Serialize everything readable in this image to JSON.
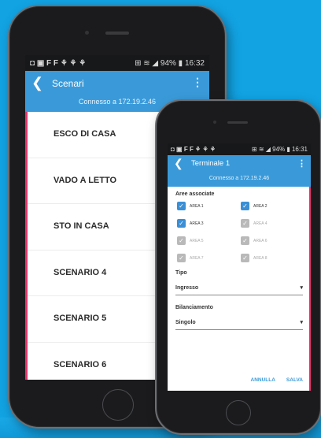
{
  "phone1": {
    "status_left": "◘ ▣ F F ⚘ ⚘ ⚘",
    "status_right": "⊞ ≋ ◢ 94% ▮ 16:32",
    "title": "Scenari",
    "subtitle": "Connesso a 172.19.2.46",
    "scenari": [
      "ESCO DI CASA",
      "VADO A LETTO",
      "STO IN CASA",
      "SCENARIO 4",
      "SCENARIO 5",
      "SCENARIO 6"
    ]
  },
  "phone2": {
    "status_left": "◘ ▣ F F ⚘ ⚘ ⚘",
    "status_right": "⊞ ≋ ◢ 94% ▮ 16:31",
    "title": "Terminale 1",
    "subtitle": "Connesso a 172.19.2.46",
    "aree_label": "Aree associate",
    "aree": [
      {
        "label": "AREA 1",
        "checked": true
      },
      {
        "label": "AREA 2",
        "checked": true
      },
      {
        "label": "AREA 3",
        "checked": true
      },
      {
        "label": "AREA 4",
        "checked": false
      },
      {
        "label": "AREA 5",
        "checked": false
      },
      {
        "label": "AREA 6",
        "checked": false
      },
      {
        "label": "AREA 7",
        "checked": false
      },
      {
        "label": "AREA 8",
        "checked": false
      }
    ],
    "tipo_label": "Tipo",
    "tipo_value": "Ingresso",
    "bil_label": "Bilanciamento",
    "bil_value": "Singolo",
    "annulla": "ANNULLA",
    "salva": "SALVA"
  },
  "colors": {
    "background": "#12a3e3",
    "appbar": "#3a9ad9",
    "accent": "#e8336b",
    "checkbox": "#3a8fd6"
  }
}
